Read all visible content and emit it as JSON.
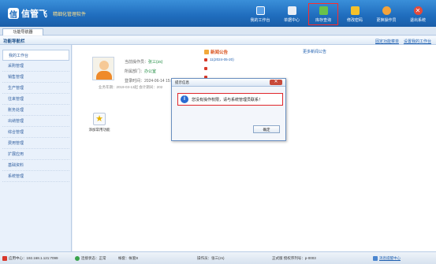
{
  "header": {
    "brand": "信管飞",
    "subtitle": "精细化管理软件",
    "toolbar": [
      {
        "label": "我的工作台",
        "icon": "monitor-icon",
        "color": "#5aa0e6"
      },
      {
        "label": "单据中心",
        "icon": "document-icon",
        "color": "#e8edf5"
      },
      {
        "label": "库存查询",
        "icon": "search-doc-icon",
        "color": "#69c24a",
        "selected": true
      },
      {
        "label": "修改密码",
        "icon": "lock-icon",
        "color": "#f5c12b"
      },
      {
        "label": "更换操作员",
        "icon": "user-switch-icon",
        "color": "#f3a33b"
      },
      {
        "label": "退出系统",
        "icon": "exit-icon",
        "color": "#e64a3a"
      }
    ]
  },
  "tabbar": {
    "tab": "功能导航器"
  },
  "navhead": {
    "title": "功能导航栏",
    "links": [
      "固定功能菜单",
      "设置我的工作台"
    ]
  },
  "sidebar": {
    "items": [
      "我的工作台",
      "采购管理",
      "销售管理",
      "生产管理",
      "往来管理",
      "账务处理",
      "出纳管理",
      "综合管理",
      "费用管理",
      "扩展应用",
      "基础资料",
      "系统管理"
    ]
  },
  "profile": {
    "operator_label": "当前操作员：",
    "operator_value": "张三(zs)",
    "dept_label": "所属部门：",
    "dept_value": "办公室",
    "login_label": "登录时间：",
    "login_value": "2024-06-14 15:21",
    "biz_line": "业务年期：2019-03-13起    会计期间：202"
  },
  "news": {
    "title": "新闻公告",
    "more": "更多新闻公告",
    "items": [
      {
        "text": "11(2024-05-20)"
      },
      {
        "text": ""
      },
      {
        "text": ""
      },
      {
        "text": ""
      }
    ]
  },
  "quick": {
    "label": "添加常用功能"
  },
  "modal": {
    "title": "提示信息",
    "message": "您没有操作权限，请与系统管理员联系！",
    "ok": "确定"
  },
  "status": {
    "server": "应用中心：192.168.1.121:7099",
    "conn": "连接状态：正常",
    "acct": "帐套：帐套8",
    "operator": "操作员：张三(zs)",
    "version": "正式版 授权序列号：p-0003",
    "msg": "消息提醒中心"
  }
}
